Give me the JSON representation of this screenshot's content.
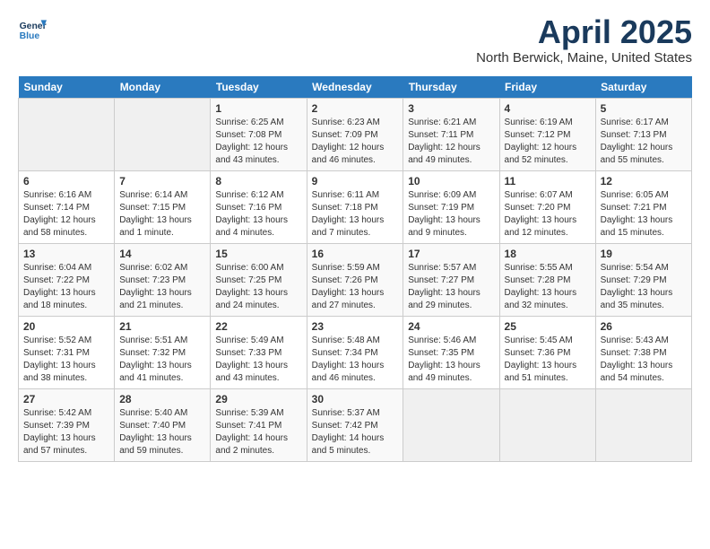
{
  "logo": {
    "line1": "General",
    "line2": "Blue"
  },
  "title": "April 2025",
  "subtitle": "North Berwick, Maine, United States",
  "days_of_week": [
    "Sunday",
    "Monday",
    "Tuesday",
    "Wednesday",
    "Thursday",
    "Friday",
    "Saturday"
  ],
  "weeks": [
    [
      {
        "day": "",
        "empty": true
      },
      {
        "day": "",
        "empty": true
      },
      {
        "day": "1",
        "sunrise": "Sunrise: 6:25 AM",
        "sunset": "Sunset: 7:08 PM",
        "daylight": "Daylight: 12 hours and 43 minutes."
      },
      {
        "day": "2",
        "sunrise": "Sunrise: 6:23 AM",
        "sunset": "Sunset: 7:09 PM",
        "daylight": "Daylight: 12 hours and 46 minutes."
      },
      {
        "day": "3",
        "sunrise": "Sunrise: 6:21 AM",
        "sunset": "Sunset: 7:11 PM",
        "daylight": "Daylight: 12 hours and 49 minutes."
      },
      {
        "day": "4",
        "sunrise": "Sunrise: 6:19 AM",
        "sunset": "Sunset: 7:12 PM",
        "daylight": "Daylight: 12 hours and 52 minutes."
      },
      {
        "day": "5",
        "sunrise": "Sunrise: 6:17 AM",
        "sunset": "Sunset: 7:13 PM",
        "daylight": "Daylight: 12 hours and 55 minutes."
      }
    ],
    [
      {
        "day": "6",
        "sunrise": "Sunrise: 6:16 AM",
        "sunset": "Sunset: 7:14 PM",
        "daylight": "Daylight: 12 hours and 58 minutes."
      },
      {
        "day": "7",
        "sunrise": "Sunrise: 6:14 AM",
        "sunset": "Sunset: 7:15 PM",
        "daylight": "Daylight: 13 hours and 1 minute."
      },
      {
        "day": "8",
        "sunrise": "Sunrise: 6:12 AM",
        "sunset": "Sunset: 7:16 PM",
        "daylight": "Daylight: 13 hours and 4 minutes."
      },
      {
        "day": "9",
        "sunrise": "Sunrise: 6:11 AM",
        "sunset": "Sunset: 7:18 PM",
        "daylight": "Daylight: 13 hours and 7 minutes."
      },
      {
        "day": "10",
        "sunrise": "Sunrise: 6:09 AM",
        "sunset": "Sunset: 7:19 PM",
        "daylight": "Daylight: 13 hours and 9 minutes."
      },
      {
        "day": "11",
        "sunrise": "Sunrise: 6:07 AM",
        "sunset": "Sunset: 7:20 PM",
        "daylight": "Daylight: 13 hours and 12 minutes."
      },
      {
        "day": "12",
        "sunrise": "Sunrise: 6:05 AM",
        "sunset": "Sunset: 7:21 PM",
        "daylight": "Daylight: 13 hours and 15 minutes."
      }
    ],
    [
      {
        "day": "13",
        "sunrise": "Sunrise: 6:04 AM",
        "sunset": "Sunset: 7:22 PM",
        "daylight": "Daylight: 13 hours and 18 minutes."
      },
      {
        "day": "14",
        "sunrise": "Sunrise: 6:02 AM",
        "sunset": "Sunset: 7:23 PM",
        "daylight": "Daylight: 13 hours and 21 minutes."
      },
      {
        "day": "15",
        "sunrise": "Sunrise: 6:00 AM",
        "sunset": "Sunset: 7:25 PM",
        "daylight": "Daylight: 13 hours and 24 minutes."
      },
      {
        "day": "16",
        "sunrise": "Sunrise: 5:59 AM",
        "sunset": "Sunset: 7:26 PM",
        "daylight": "Daylight: 13 hours and 27 minutes."
      },
      {
        "day": "17",
        "sunrise": "Sunrise: 5:57 AM",
        "sunset": "Sunset: 7:27 PM",
        "daylight": "Daylight: 13 hours and 29 minutes."
      },
      {
        "day": "18",
        "sunrise": "Sunrise: 5:55 AM",
        "sunset": "Sunset: 7:28 PM",
        "daylight": "Daylight: 13 hours and 32 minutes."
      },
      {
        "day": "19",
        "sunrise": "Sunrise: 5:54 AM",
        "sunset": "Sunset: 7:29 PM",
        "daylight": "Daylight: 13 hours and 35 minutes."
      }
    ],
    [
      {
        "day": "20",
        "sunrise": "Sunrise: 5:52 AM",
        "sunset": "Sunset: 7:31 PM",
        "daylight": "Daylight: 13 hours and 38 minutes."
      },
      {
        "day": "21",
        "sunrise": "Sunrise: 5:51 AM",
        "sunset": "Sunset: 7:32 PM",
        "daylight": "Daylight: 13 hours and 41 minutes."
      },
      {
        "day": "22",
        "sunrise": "Sunrise: 5:49 AM",
        "sunset": "Sunset: 7:33 PM",
        "daylight": "Daylight: 13 hours and 43 minutes."
      },
      {
        "day": "23",
        "sunrise": "Sunrise: 5:48 AM",
        "sunset": "Sunset: 7:34 PM",
        "daylight": "Daylight: 13 hours and 46 minutes."
      },
      {
        "day": "24",
        "sunrise": "Sunrise: 5:46 AM",
        "sunset": "Sunset: 7:35 PM",
        "daylight": "Daylight: 13 hours and 49 minutes."
      },
      {
        "day": "25",
        "sunrise": "Sunrise: 5:45 AM",
        "sunset": "Sunset: 7:36 PM",
        "daylight": "Daylight: 13 hours and 51 minutes."
      },
      {
        "day": "26",
        "sunrise": "Sunrise: 5:43 AM",
        "sunset": "Sunset: 7:38 PM",
        "daylight": "Daylight: 13 hours and 54 minutes."
      }
    ],
    [
      {
        "day": "27",
        "sunrise": "Sunrise: 5:42 AM",
        "sunset": "Sunset: 7:39 PM",
        "daylight": "Daylight: 13 hours and 57 minutes."
      },
      {
        "day": "28",
        "sunrise": "Sunrise: 5:40 AM",
        "sunset": "Sunset: 7:40 PM",
        "daylight": "Daylight: 13 hours and 59 minutes."
      },
      {
        "day": "29",
        "sunrise": "Sunrise: 5:39 AM",
        "sunset": "Sunset: 7:41 PM",
        "daylight": "Daylight: 14 hours and 2 minutes."
      },
      {
        "day": "30",
        "sunrise": "Sunrise: 5:37 AM",
        "sunset": "Sunset: 7:42 PM",
        "daylight": "Daylight: 14 hours and 5 minutes."
      },
      {
        "day": "",
        "empty": true
      },
      {
        "day": "",
        "empty": true
      },
      {
        "day": "",
        "empty": true
      }
    ]
  ]
}
